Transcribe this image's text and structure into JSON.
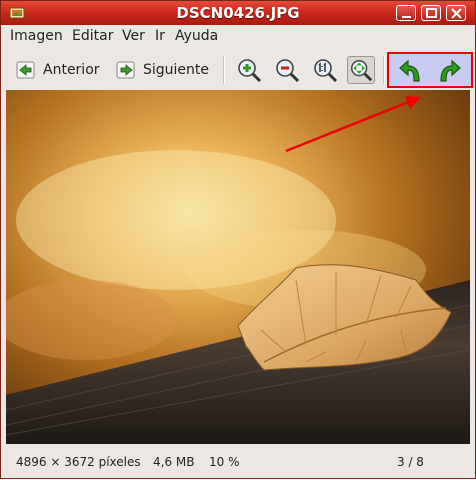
{
  "window": {
    "title": "DSCN0426.JPG",
    "controls": [
      "minimize",
      "maximize",
      "close"
    ]
  },
  "menu": {
    "items": [
      "Imagen",
      "Editar",
      "Ver",
      "Ir",
      "Ayuda"
    ]
  },
  "toolbar": {
    "previous_label": "Anterior",
    "next_label": "Siguiente",
    "icons": [
      "zoom-in-icon",
      "zoom-out-icon",
      "zoom-normal-icon",
      "zoom-fit-icon",
      "rotate-left-icon",
      "rotate-right-icon"
    ]
  },
  "status": {
    "dimensions": "4896 × 3672 píxeles",
    "size": "4,6 MB",
    "zoom": "10 %",
    "position": "3 / 8"
  },
  "colors": {
    "titlebar": "#c9271a",
    "highlight_border": "#ee0000",
    "highlight_fill": "#c9cbf2",
    "annotation_arrow": "#ee0000"
  }
}
